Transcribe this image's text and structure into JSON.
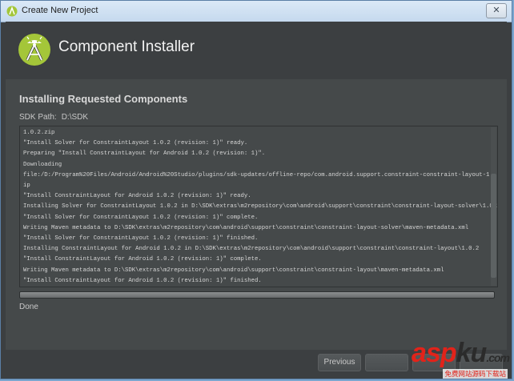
{
  "window": {
    "title": "Create New Project",
    "close_glyph": "✕"
  },
  "header": {
    "title": "Component Installer",
    "logo_icon": "android-studio-logo-icon"
  },
  "main": {
    "section_title": "Installing Requested Components",
    "sdk_path_label": "SDK Path:",
    "sdk_path_value": "D:\\SDK",
    "log_lines": [
      "1.0.2.zip",
      "\"Install Solver for ConstraintLayout 1.0.2 (revision: 1)\" ready.",
      "Preparing \"Install ConstraintLayout for Android 1.0.2 (revision: 1)\".",
      "Downloading",
      "file:/D:/Program%20Files/Android/Android%20Studio/plugins/sdk-updates/offline-repo/com.android.support.constraint-constraint-layout-1.0.2.z",
      "ip",
      "\"Install ConstraintLayout for Android 1.0.2 (revision: 1)\" ready.",
      "Installing Solver for ConstraintLayout 1.0.2 in D:\\SDK\\extras\\m2repository\\com\\android\\support\\constraint\\constraint-layout-solver\\1.0.2",
      "\"Install Solver for ConstraintLayout 1.0.2 (revision: 1)\" complete.",
      "Writing Maven metadata to D:\\SDK\\extras\\m2repository\\com\\android\\support\\constraint\\constraint-layout-solver\\maven-metadata.xml",
      "\"Install Solver for ConstraintLayout 1.0.2 (revision: 1)\" finished.",
      "Installing ConstraintLayout for Android 1.0.2 in D:\\SDK\\extras\\m2repository\\com\\android\\support\\constraint\\constraint-layout\\1.0.2",
      "\"Install ConstraintLayout for Android 1.0.2 (revision: 1)\" complete.",
      "Writing Maven metadata to D:\\SDK\\extras\\m2repository\\com\\android\\support\\constraint\\constraint-layout\\maven-metadata.xml",
      "\"Install ConstraintLayout for Android 1.0.2 (revision: 1)\" finished."
    ],
    "progress_fraction": 1.0,
    "status": "Done"
  },
  "footer": {
    "previous_label": "Previous",
    "next_label": "",
    "cancel_label": "",
    "finish_label": ""
  },
  "watermark": {
    "text_red": "asp",
    "text_dark": "ku",
    "suffix": ".com",
    "sub": "免费网站源码下载站"
  },
  "colors": {
    "accent_green": "#a4c639",
    "dialog_bg": "#3c3f41",
    "content_bg": "#45494a"
  }
}
